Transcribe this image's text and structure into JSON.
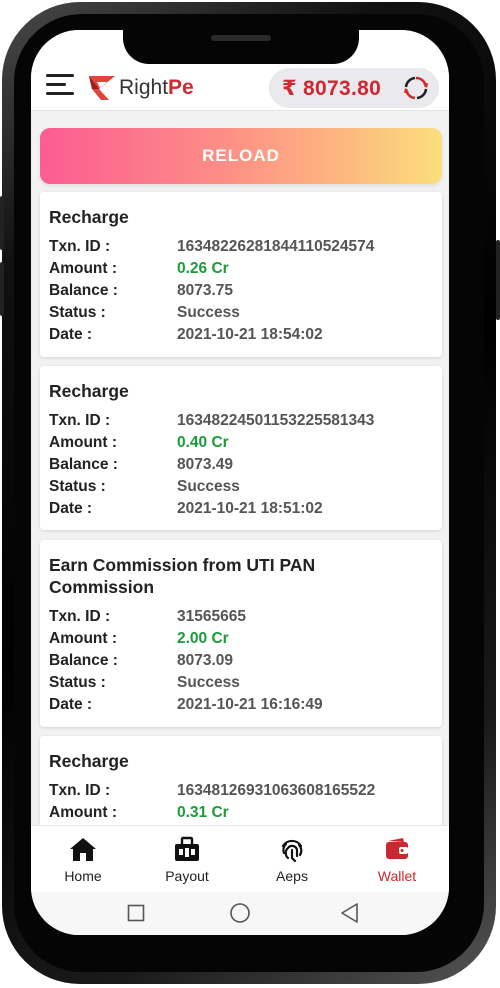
{
  "header": {
    "brand_prefix": "Right",
    "brand_suffix": "Pe",
    "balance": "₹ 8073.80",
    "menu_icon": "hamburger-menu-icon",
    "refresh_icon": "refresh-icon"
  },
  "reload": {
    "label": "RELOAD"
  },
  "labels": {
    "txn_id": "Txn. ID :",
    "amount": "Amount :",
    "balance": "Balance :",
    "status": "Status :",
    "date": "Date :"
  },
  "transactions": [
    {
      "title": "Recharge",
      "txn_id": "16348226281844110524574",
      "amount": "0.26 Cr",
      "balance": "8073.75",
      "status": "Success",
      "date": "2021-10-21 18:54:02"
    },
    {
      "title": "Recharge",
      "txn_id": "16348224501153225581343",
      "amount": "0.40 Cr",
      "balance": "8073.49",
      "status": "Success",
      "date": "2021-10-21 18:51:02"
    },
    {
      "title": "Earn Commission from  UTI PAN Commission",
      "txn_id": "31565665",
      "amount": "2.00 Cr",
      "balance": "8073.09",
      "status": "Success",
      "date": "2021-10-21 16:16:49"
    },
    {
      "title": "Recharge",
      "txn_id": "16348126931063608165522",
      "amount": "0.31 Cr",
      "balance": "",
      "status": "",
      "date": ""
    }
  ],
  "nav": [
    {
      "label": "Home",
      "icon": "home-icon",
      "active": false
    },
    {
      "label": "Payout",
      "icon": "payout-icon",
      "active": false
    },
    {
      "label": "Aeps",
      "icon": "fingerprint-icon",
      "active": false
    },
    {
      "label": "Wallet",
      "icon": "wallet-icon",
      "active": true
    }
  ],
  "colors": {
    "accent_red": "#d0282e",
    "amount_green": "#1a9c3a",
    "reload_gradient_start": "#fc5c92",
    "reload_gradient_end": "#fbdf7d"
  }
}
